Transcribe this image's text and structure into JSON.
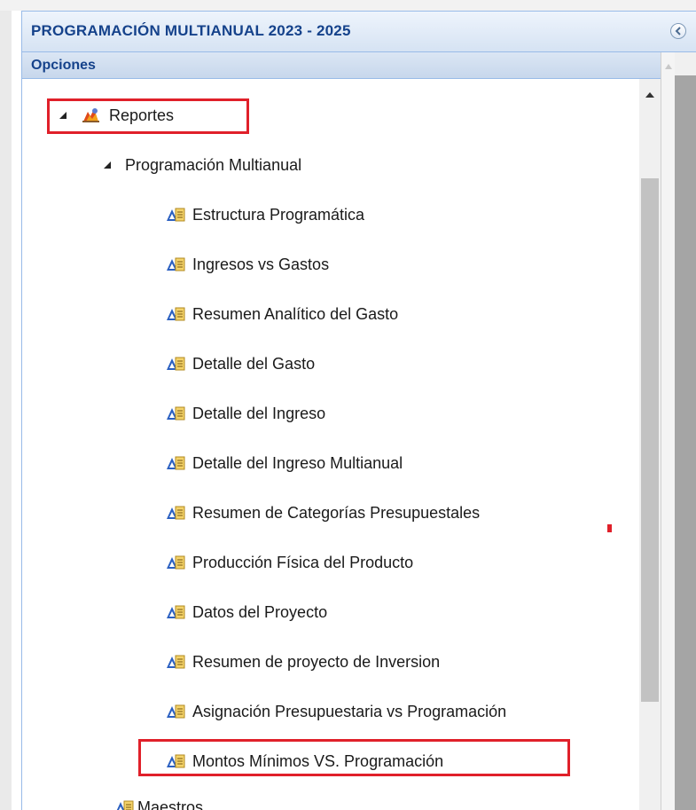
{
  "panel": {
    "title": "PROGRAMACIÓN MULTIANUAL 2023 - 2025",
    "section_label": "Opciones"
  },
  "tree": {
    "root": {
      "label": "Reportes",
      "icon": "reports-folder-icon",
      "expanded": true
    },
    "group": {
      "label": "Programación Multianual",
      "expanded": true
    },
    "items": [
      {
        "label": "Estructura Programática",
        "icon": "report-icon"
      },
      {
        "label": "Ingresos vs Gastos",
        "icon": "report-icon"
      },
      {
        "label": "Resumen Analítico del Gasto",
        "icon": "report-icon"
      },
      {
        "label": "Detalle del Gasto",
        "icon": "report-icon"
      },
      {
        "label": "Detalle del Ingreso",
        "icon": "report-icon"
      },
      {
        "label": "Detalle del Ingreso Multianual",
        "icon": "report-icon"
      },
      {
        "label": "Resumen de Categorías Presupuestales",
        "icon": "report-icon"
      },
      {
        "label": "Producción Física del Producto",
        "icon": "report-icon"
      },
      {
        "label": "Datos del Proyecto",
        "icon": "report-icon"
      },
      {
        "label": "Resumen de proyecto de Inversion",
        "icon": "report-icon"
      },
      {
        "label": "Asignación Presupuestaria vs Programación",
        "icon": "report-icon"
      },
      {
        "label": "Montos Mínimos VS. Programación",
        "icon": "report-icon",
        "highlighted": true
      }
    ],
    "sibling": {
      "label": "Maestros",
      "icon": "report-icon"
    }
  },
  "colors": {
    "header_text": "#15428b",
    "highlight": "#e0202a",
    "panel_border": "#99bbe8"
  }
}
